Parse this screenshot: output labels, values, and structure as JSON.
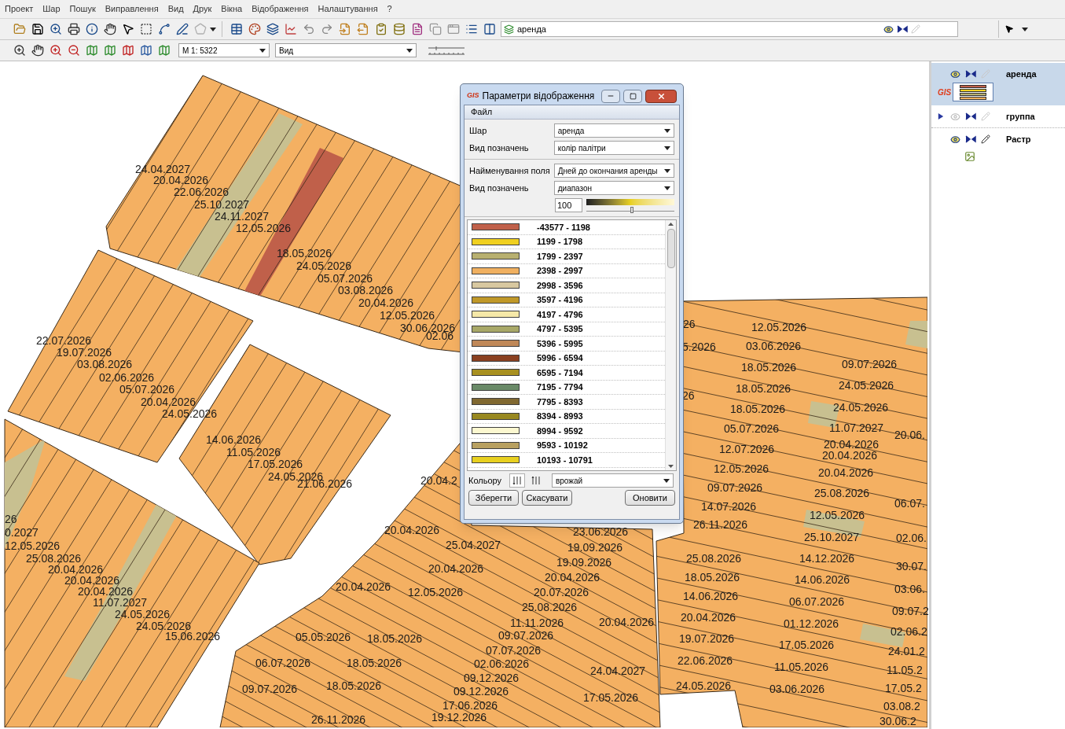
{
  "menu": [
    "Проект",
    "Шар",
    "Пошук",
    "Виправлення",
    "Вид",
    "Друк",
    "Вікна",
    "Відображення",
    "Налаштування",
    "?"
  ],
  "toolbar": {
    "layer_combo": "аренда",
    "scale_combo": "М 1: 5322",
    "view_combo": "Вид"
  },
  "map": {
    "labels": [
      "24.04.2027",
      "20.04.2026",
      "22.06.2026",
      "25.10.2027",
      "24.11.2027",
      "12.05.2026",
      "18.05.2026",
      "24.05.2026",
      "05.07.2026",
      "03.08.2026",
      "20.04.2026",
      "12.05.2026",
      "30.06.2026",
      "02.06",
      "22.07.2026",
      "19.07.2026",
      "03.08.2026",
      "02.06.2026",
      "05.07.2026",
      "20.04.2026",
      "24.05.2026",
      "14.06.2026",
      "11.05.2026",
      "17.05.2026",
      "24.05.2026",
      "21.06.2026",
      "26",
      "0.2027",
      "12.05.2026",
      "25.08.2026",
      "20.04.2026",
      "20.04.2026",
      "20.04.2026",
      "11.07.2027",
      "24.05.2026",
      "24.05.2026",
      "15.06.2026",
      "20.04.2",
      "20.04.2026",
      "25.04.2027",
      "20.04.2026",
      "20.04.2026",
      "12.05.2026",
      "23.06.2026",
      "19.09.2026",
      "19.09.2026",
      "20.04.2026",
      "20.07.2026",
      "25.08.2026",
      "11.11.2026",
      "20.04.2026",
      "09.07.2026",
      "07.07.2026",
      "02.06.2026",
      "09.12.2026",
      "09.12.2026",
      "17.06.2026",
      "19.12.2026",
      "05.05.2026",
      "18.05.2026",
      "06.07.2026",
      "18.05.2026",
      "09.07.2026",
      "18.05.2026",
      "26.11.2026",
      "24.04.2027",
      "17.05.2026",
      "26",
      "5.2026",
      "26",
      "12.05.2026",
      "03.06.2026",
      "18.05.2026",
      "18.05.2026",
      "18.05.2026",
      "05.07.2026",
      "12.07.2026",
      "12.05.2026",
      "09.07.2026",
      "14.07.2026",
      "26.11.2026",
      "09.07.2026",
      "24.05.2026",
      "24.05.2026",
      "11.07.2027",
      "20.04.2026",
      "20.04.2026",
      "20.04.2026",
      "25.08.2026",
      "12.05.2026",
      "25.10.2027",
      "14.12.2026",
      "14.06.2026",
      "06.07.2026",
      "01.12.2026",
      "17.05.2026",
      "11.05.2026",
      "03.06.2026",
      "25.08.2026",
      "18.05.2026",
      "14.06.2026",
      "20.04.2026",
      "19.07.2026",
      "22.06.2026",
      "24.05.2026",
      "20.06.",
      "06.07.",
      "02.06.",
      "30.07.",
      "03.06.",
      "09.07.2",
      "02.06.2",
      "24.01.2",
      "11.05.2",
      "17.05.2",
      "03.08.2",
      "30.06.2"
    ]
  },
  "dialog": {
    "logo": "GIS",
    "title": "Параметри відображення",
    "menu": [
      "Файл"
    ],
    "sections": [
      [
        {
          "label": "Шар",
          "value": "аренда"
        },
        {
          "label": "Вид позначень",
          "value": "колір палітри"
        }
      ],
      [
        {
          "label": "Найменування поля",
          "value": "Дней до окончания аренды"
        },
        {
          "label": "Вид позначень",
          "value": "диапазон"
        }
      ]
    ],
    "transparency": "100",
    "slider": {
      "level": 0.52
    },
    "legend": [
      {
        "range": "-43577 - 1198",
        "color": "#c0604a"
      },
      {
        "range": "1199 - 1798",
        "color": "#f0d020"
      },
      {
        "range": "1799 - 2397",
        "color": "#b8b070"
      },
      {
        "range": "2398 - 2997",
        "color": "#f0b060"
      },
      {
        "range": "2998 - 3596",
        "color": "#d8c8a0"
      },
      {
        "range": "3597 - 4196",
        "color": "#c09828"
      },
      {
        "range": "4197 - 4796",
        "color": "#f5e8a8"
      },
      {
        "range": "4797 - 5395",
        "color": "#a8a868"
      },
      {
        "range": "5396 - 5995",
        "color": "#c08858"
      },
      {
        "range": "5996 - 6594",
        "color": "#8a4020"
      },
      {
        "range": "6595 - 7194",
        "color": "#a89020"
      },
      {
        "range": "7195 - 7794",
        "color": "#6a8a68"
      },
      {
        "range": "7795 - 8393",
        "color": "#806830"
      },
      {
        "range": "8394 - 8993",
        "color": "#988820"
      },
      {
        "range": "8994 - 9592",
        "color": "#fcf8d0"
      },
      {
        "range": "9593 - 10192",
        "color": "#b8a060"
      },
      {
        "range": "10193 - 10791",
        "color": "#e8d020"
      }
    ],
    "sort_label": "Кольору",
    "sort_buttons": [
      {
        "selected": true
      },
      {
        "selected": false
      }
    ],
    "sort_field": "врожай",
    "buttons": [
      "Зберегти",
      "Скасувати",
      "Оновити"
    ]
  },
  "layers": [
    {
      "kind": "vector",
      "logo": "GIS",
      "name": "аренда",
      "selected": true,
      "visible": true,
      "editable": false
    },
    {
      "kind": "group",
      "name": "группа",
      "selected": false,
      "visible": false,
      "editable": false,
      "expanded": false
    },
    {
      "kind": "raster",
      "name": "Растр",
      "selected": false,
      "visible": true,
      "editable": true
    }
  ]
}
